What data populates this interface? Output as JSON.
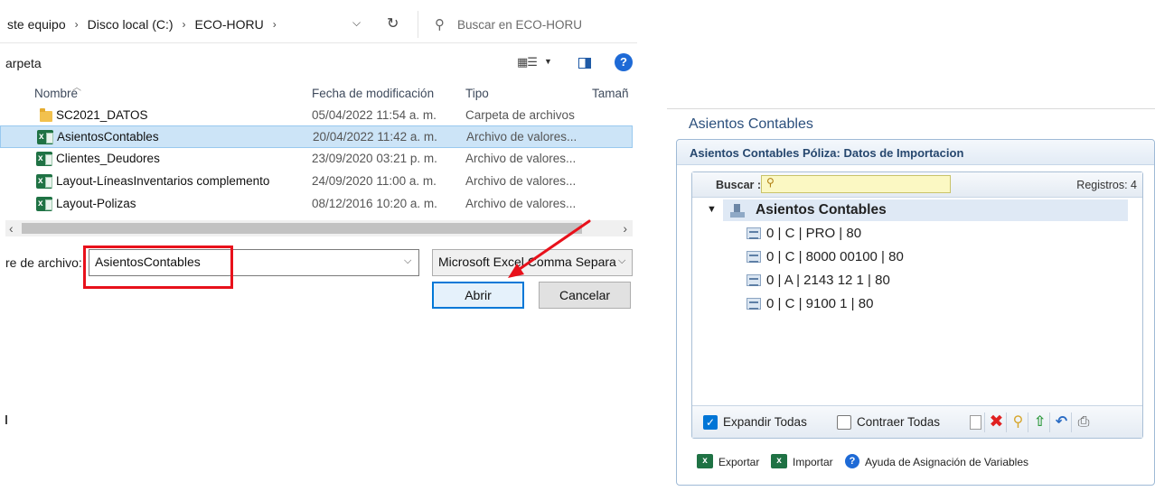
{
  "file_dialog": {
    "breadcrumb": [
      "ste equipo",
      "Disco local (C:)",
      "ECO-HORU"
    ],
    "search_placeholder": "Buscar en ECO-HORU",
    "toolbar": {
      "new_folder": "arpeta"
    },
    "columns": {
      "name": "Nombre",
      "date": "Fecha de modificación",
      "type": "Tipo",
      "size": "Tamañ"
    },
    "files": [
      {
        "name": "SC2021_DATOS",
        "date": "05/04/2022 11:54 a. m.",
        "type": "Carpeta de archivos",
        "icon": "folder-icon"
      },
      {
        "name": "AsientosContables",
        "date": "20/04/2022 11:42 a. m.",
        "type": "Archivo de valores...",
        "icon": "excel-csv-icon",
        "selected": true
      },
      {
        "name": "Clientes_Deudores",
        "date": "23/09/2020 03:21 p. m.",
        "type": "Archivo de valores...",
        "icon": "excel-csv-icon"
      },
      {
        "name": "Layout-LíneasInventarios complemento",
        "date": "24/09/2020 11:00 a. m.",
        "type": "Archivo de valores...",
        "icon": "excel-csv-icon"
      },
      {
        "name": "Layout-Polizas",
        "date": "08/12/2016 10:20 a. m.",
        "type": "Archivo de valores...",
        "icon": "excel-csv-icon"
      }
    ],
    "filename_label": "re de archivo:",
    "filename_value": "AsientosContables",
    "filetype_value": "Microsoft Excel Comma Separa",
    "open_label": "Abrir",
    "cancel_label": "Cancelar",
    "annotation_color": "#e8111b"
  },
  "app_panel": {
    "title": "Asientos Contables",
    "frame_title": "Asientos Contables Póliza: Datos de Importacion",
    "search_label": "Buscar :",
    "search_value": "",
    "records": "Registros: 4",
    "tree": {
      "root": "Asientos Contables",
      "items": [
        "0 | C | PRO | 80",
        "0 | C | 8000 00100 | 80",
        "0 | A | 2143 12 1 | 80",
        "0 | C | 9100 1 | 80"
      ]
    },
    "expand_all": "Expandir Todas",
    "expand_all_checked": true,
    "collapse_all": "Contraer Todas",
    "collapse_all_checked": false,
    "footer": {
      "export": "Exportar",
      "import": "Importar",
      "help": "Ayuda de Asignación de Variables"
    }
  }
}
